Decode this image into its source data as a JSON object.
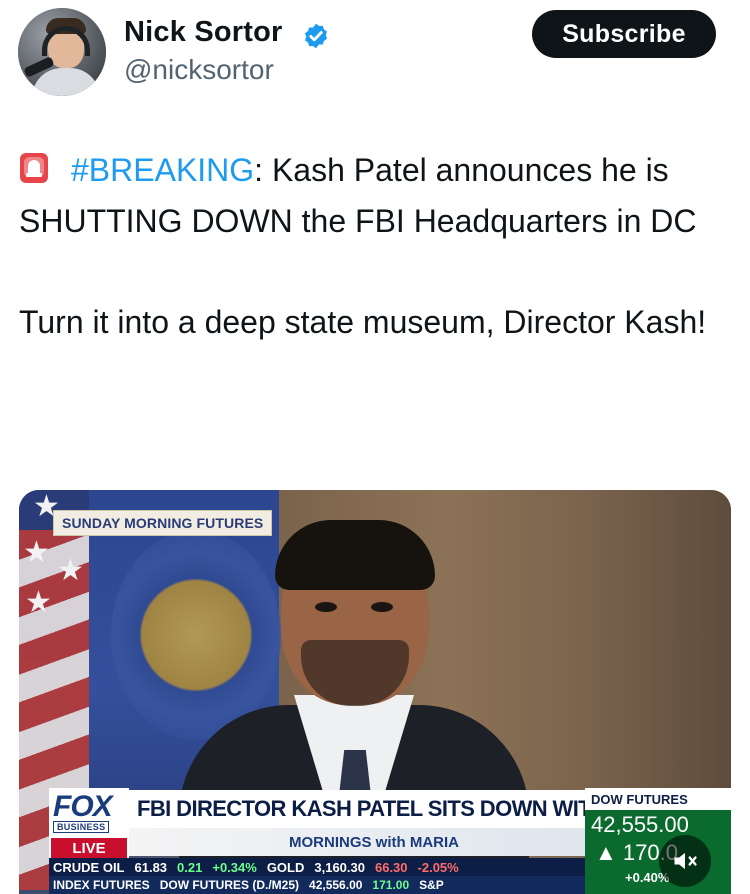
{
  "author": {
    "name": "Nick Sortor",
    "handle": "@nicksortor",
    "verified_color": "#1d9bf0"
  },
  "subscribe": {
    "label": "Subscribe"
  },
  "tweet": {
    "emoji_icon": "siren-icon",
    "hashtag": "#BREAKING",
    "line1_rest": ": Kash Patel announces he is SHUTTING DOWN the FBI Headquarters in DC",
    "line2": "Turn it into a deep state museum, Director Kash!"
  },
  "media": {
    "show_badge": "SUNDAY MORNING FUTURES",
    "logo": {
      "fox": "FOX",
      "business": "BUSINESS",
      "live": "LIVE"
    },
    "headline": "FBI DIRECTOR KASH PATEL SITS DOWN WITH MARIA",
    "subshow": "MORNINGS with MARIA",
    "market": {
      "label": "DOW FUTURES",
      "value": "42,555.00",
      "change": "170.0",
      "pct": "+0.40%"
    },
    "ticker_row1": [
      "CRUDE OIL",
      "61.83",
      "0.21",
      "+0.34%",
      "GOLD",
      "3,160.30",
      "66.30",
      "-2.05%"
    ],
    "ticker_row2": [
      "INDEX FUTURES",
      "DOW FUTURES (D./M25)",
      "42,556.00",
      "171.00",
      "S&P"
    ],
    "mute_icon": "speaker-muted-icon"
  }
}
